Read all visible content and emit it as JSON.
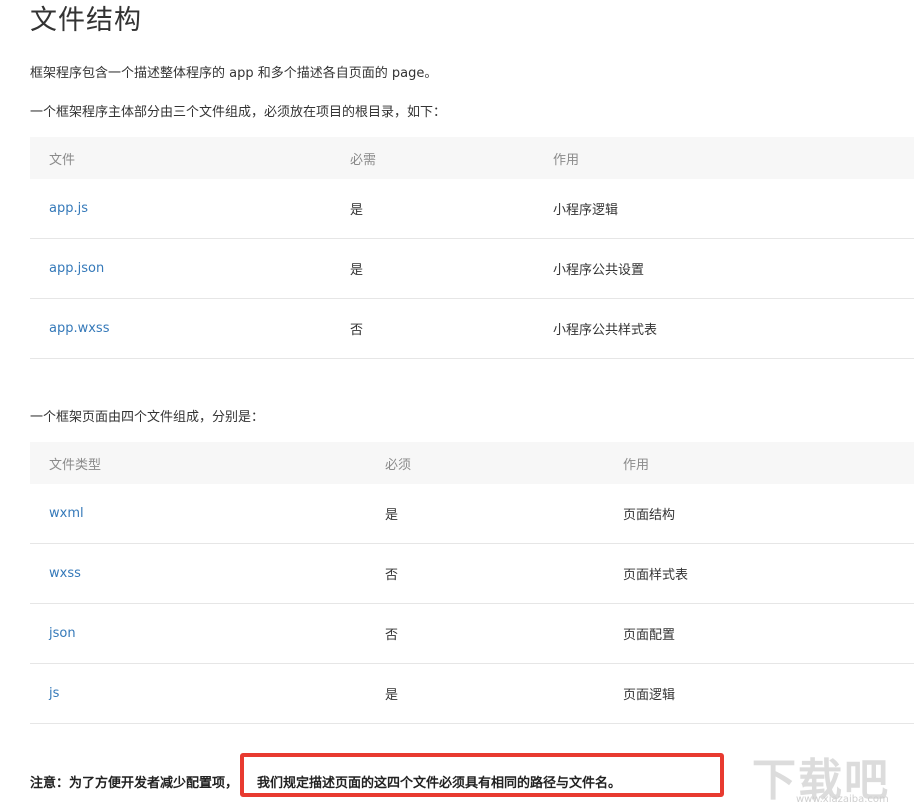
{
  "title": "文件结构",
  "intro": "框架程序包含一个描述整体程序的 app 和多个描述各自页面的 page。",
  "app_section_text": "一个框架程序主体部分由三个文件组成，必须放在项目的根目录，如下：",
  "app_table": {
    "headers": [
      "文件",
      "必需",
      "作用"
    ],
    "rows": [
      {
        "file": "app.js",
        "required": "是",
        "purpose": "小程序逻辑"
      },
      {
        "file": "app.json",
        "required": "是",
        "purpose": "小程序公共设置"
      },
      {
        "file": "app.wxss",
        "required": "否",
        "purpose": "小程序公共样式表"
      }
    ]
  },
  "page_section_text": "一个框架页面由四个文件组成，分别是：",
  "page_table": {
    "headers": [
      "文件类型",
      "必须",
      "作用"
    ],
    "rows": [
      {
        "file": "wxml",
        "required": "是",
        "purpose": "页面结构"
      },
      {
        "file": "wxss",
        "required": "否",
        "purpose": "页面样式表"
      },
      {
        "file": "json",
        "required": "否",
        "purpose": "页面配置"
      },
      {
        "file": "js",
        "required": "是",
        "purpose": "页面逻辑"
      }
    ]
  },
  "note": {
    "prefix": "注意：为了方便开发者减少配置项，",
    "highlighted": "我们规定描述页面的这四个文件必须具有相同的路径与文件名。"
  },
  "watermark": {
    "logo_text": "下载吧",
    "url": "www.xiazaiba.com"
  },
  "colors": {
    "link": "#3579b9",
    "highlight_border": "#e83a30",
    "header_bg": "#f7f7f7"
  }
}
